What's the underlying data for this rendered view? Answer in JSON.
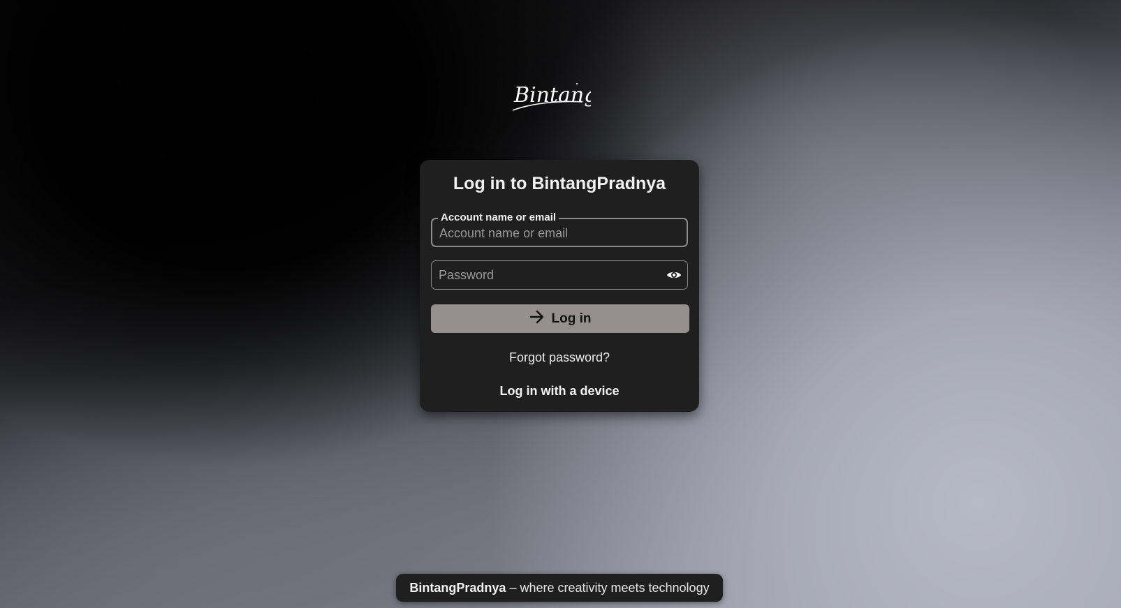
{
  "brand": {
    "logo_text": "Bintang"
  },
  "login": {
    "title": "Log in to BintangPradnya",
    "account_field": {
      "legend": "Account name or email",
      "placeholder": "Account name or email",
      "value": ""
    },
    "password_field": {
      "placeholder": "Password",
      "value": "",
      "toggle_icon": "eye-icon"
    },
    "submit": {
      "label": "Log in",
      "icon": "arrow-right-icon"
    },
    "forgot_password": "Forgot password?",
    "device_login": "Log in with a device"
  },
  "footer": {
    "brand": "BintangPradnya",
    "separator": "–",
    "tagline": "where creativity meets technology"
  },
  "colors": {
    "card_background": "#1f1f1f",
    "button_background": "#958f8f",
    "text_light": "#f2f2f2"
  }
}
